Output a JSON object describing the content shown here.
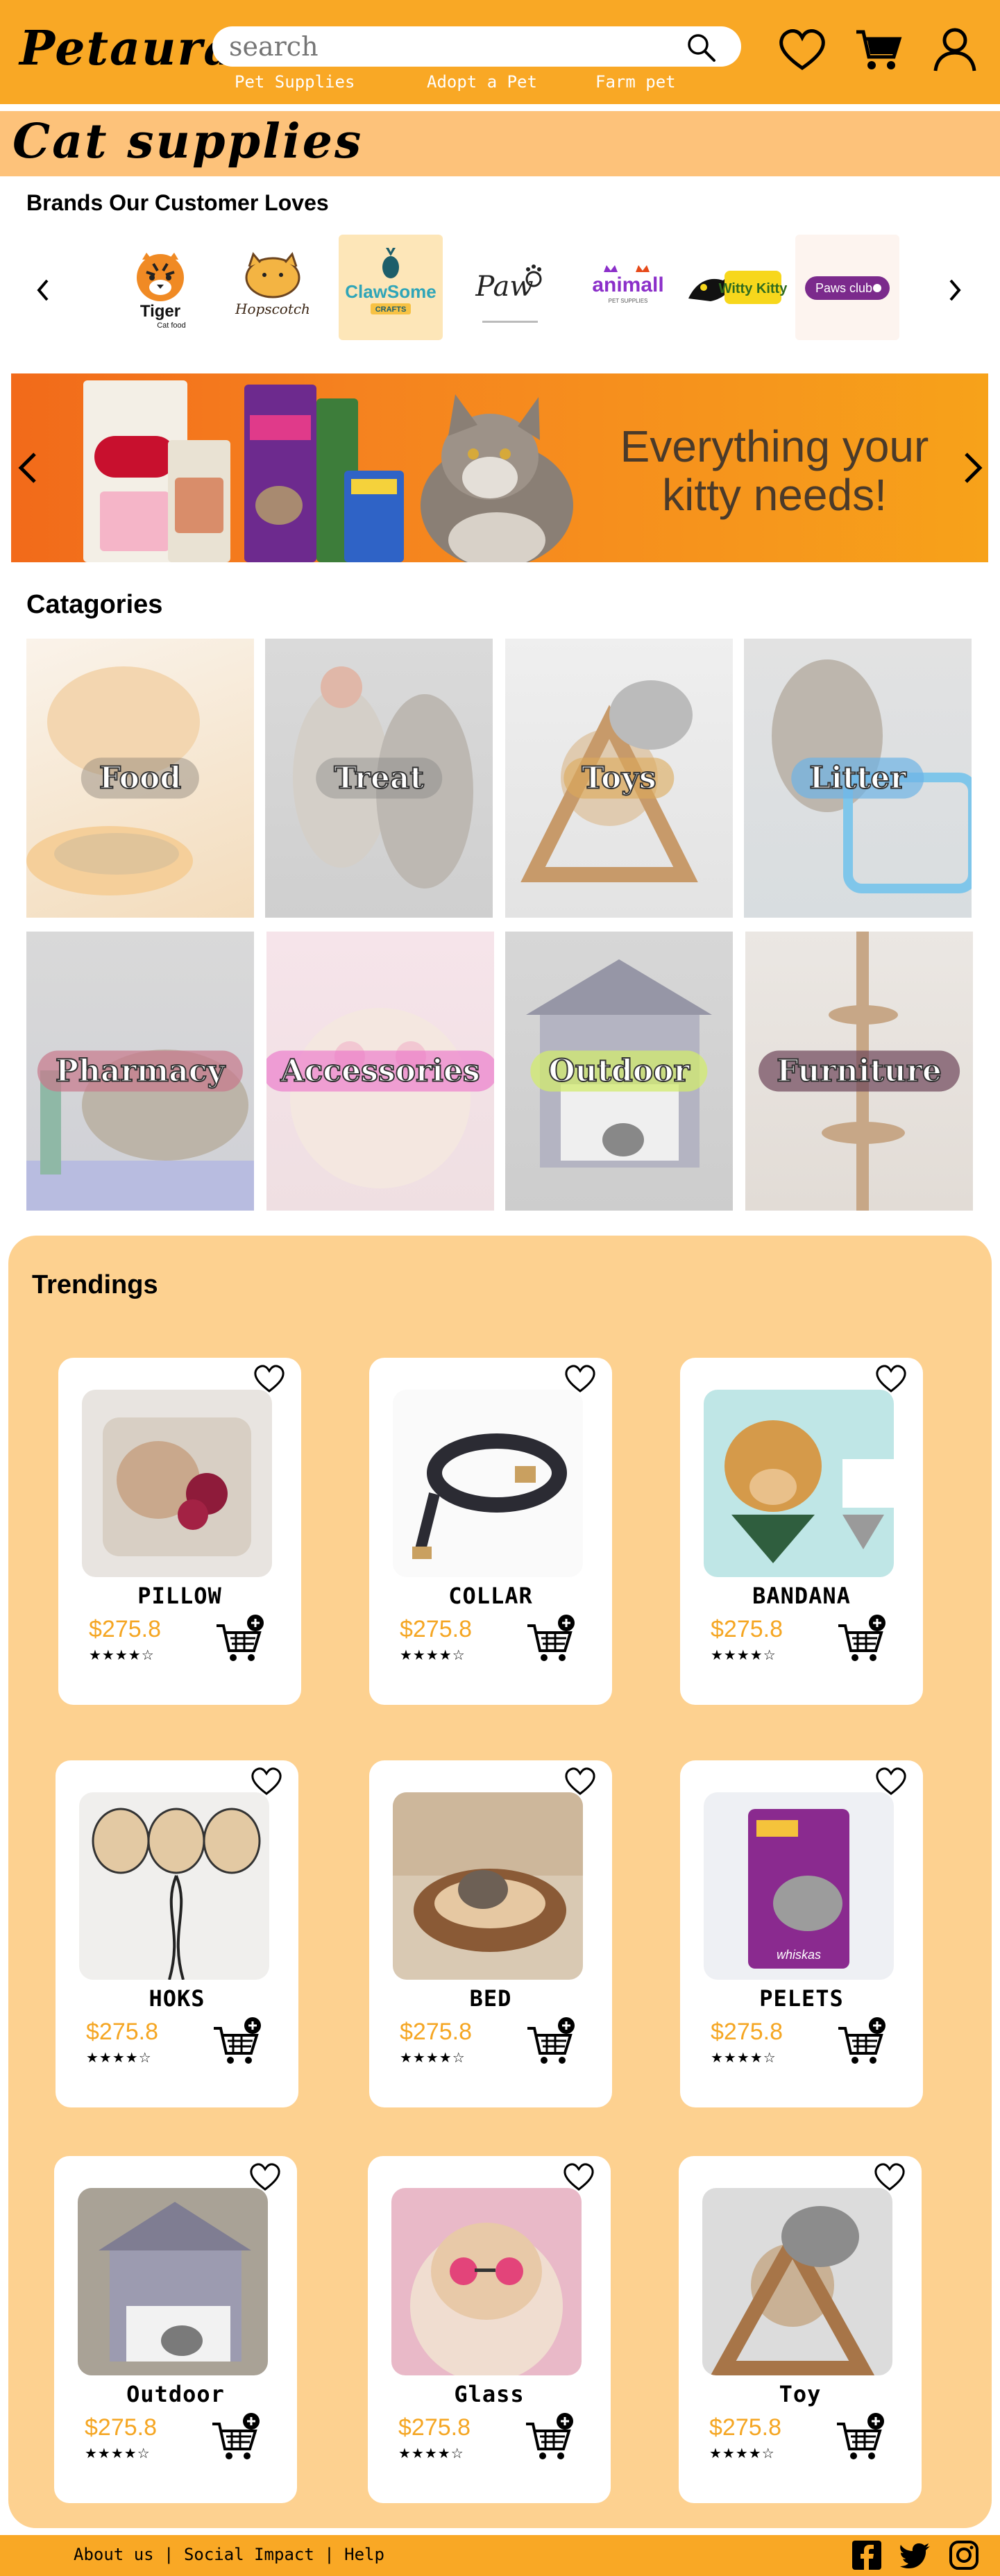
{
  "brand": {
    "name": "Petaura"
  },
  "search": {
    "placeholder": "search"
  },
  "nav": {
    "links": [
      "Pet Supplies",
      "Adopt a Pet",
      "Farm pet"
    ]
  },
  "page": {
    "title": "Cat supplies"
  },
  "brands_section": {
    "title": "Brands Our Customer Loves",
    "brands": [
      {
        "name": "Tiger",
        "sub": "Cat food"
      },
      {
        "name": "Hopscotch"
      },
      {
        "name": "ClawSome",
        "sub": "CRAFTS"
      },
      {
        "name": "Paw"
      },
      {
        "name": "animall",
        "sub": "PET SUPPLIES"
      },
      {
        "name": "Witty Kitty"
      },
      {
        "name": "Paws club"
      }
    ]
  },
  "banner": {
    "text": "Everything your kitty needs!"
  },
  "categories": {
    "title": "Catagories",
    "items": [
      "Food",
      "Treat",
      "Toys",
      "Litter",
      "Pharmacy",
      "Accessories",
      "Outdoor",
      "Furniture"
    ]
  },
  "trendings": {
    "title": "Trendings",
    "products": [
      {
        "name": "PILLOW",
        "price": "$275.8",
        "rating": "★★★★☆"
      },
      {
        "name": "COLLAR",
        "price": "$275.8",
        "rating": "★★★★☆"
      },
      {
        "name": "BANDANA",
        "price": "$275.8",
        "rating": "★★★★☆"
      },
      {
        "name": "HOKS",
        "price": "$275.8",
        "rating": "★★★★☆"
      },
      {
        "name": "BED",
        "price": "$275.8",
        "rating": "★★★★☆"
      },
      {
        "name": "PELETS",
        "price": "$275.8",
        "rating": "★★★★☆"
      },
      {
        "name": "Outdoor",
        "price": "$275.8",
        "rating": "★★★★☆"
      },
      {
        "name": "Glass",
        "price": "$275.8",
        "rating": "★★★★☆"
      },
      {
        "name": "Toy",
        "price": "$275.8",
        "rating": "★★★★☆"
      }
    ]
  },
  "footer": {
    "links": [
      "About us",
      "Social Impact",
      "Help"
    ],
    "sep": " | "
  },
  "colors": {
    "accent": "#f9a825",
    "band": "#fdc27a",
    "trend_bg": "#fdd190",
    "price": "#f5a623"
  },
  "icons": [
    "search-icon",
    "heart-icon",
    "cart-icon",
    "user-icon",
    "facebook-icon",
    "twitter-icon",
    "instagram-icon"
  ]
}
